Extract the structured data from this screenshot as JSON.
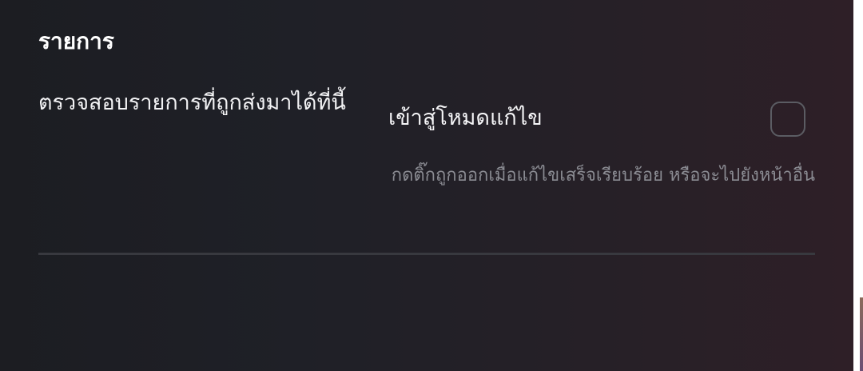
{
  "section": {
    "title": "รายการ"
  },
  "item": {
    "description": "ตรวจสอบรายการที่ถูกส่งมาได้ที่นี้",
    "edit_mode_label": "เข้าสู่โหมดแก้ไข",
    "edit_mode_checked": false,
    "hint": "กดติ๊กถูกออกเมื่อแก้ไขเสร็จเรียบร้อย หรือจะไปยังหน้าอื่น"
  }
}
